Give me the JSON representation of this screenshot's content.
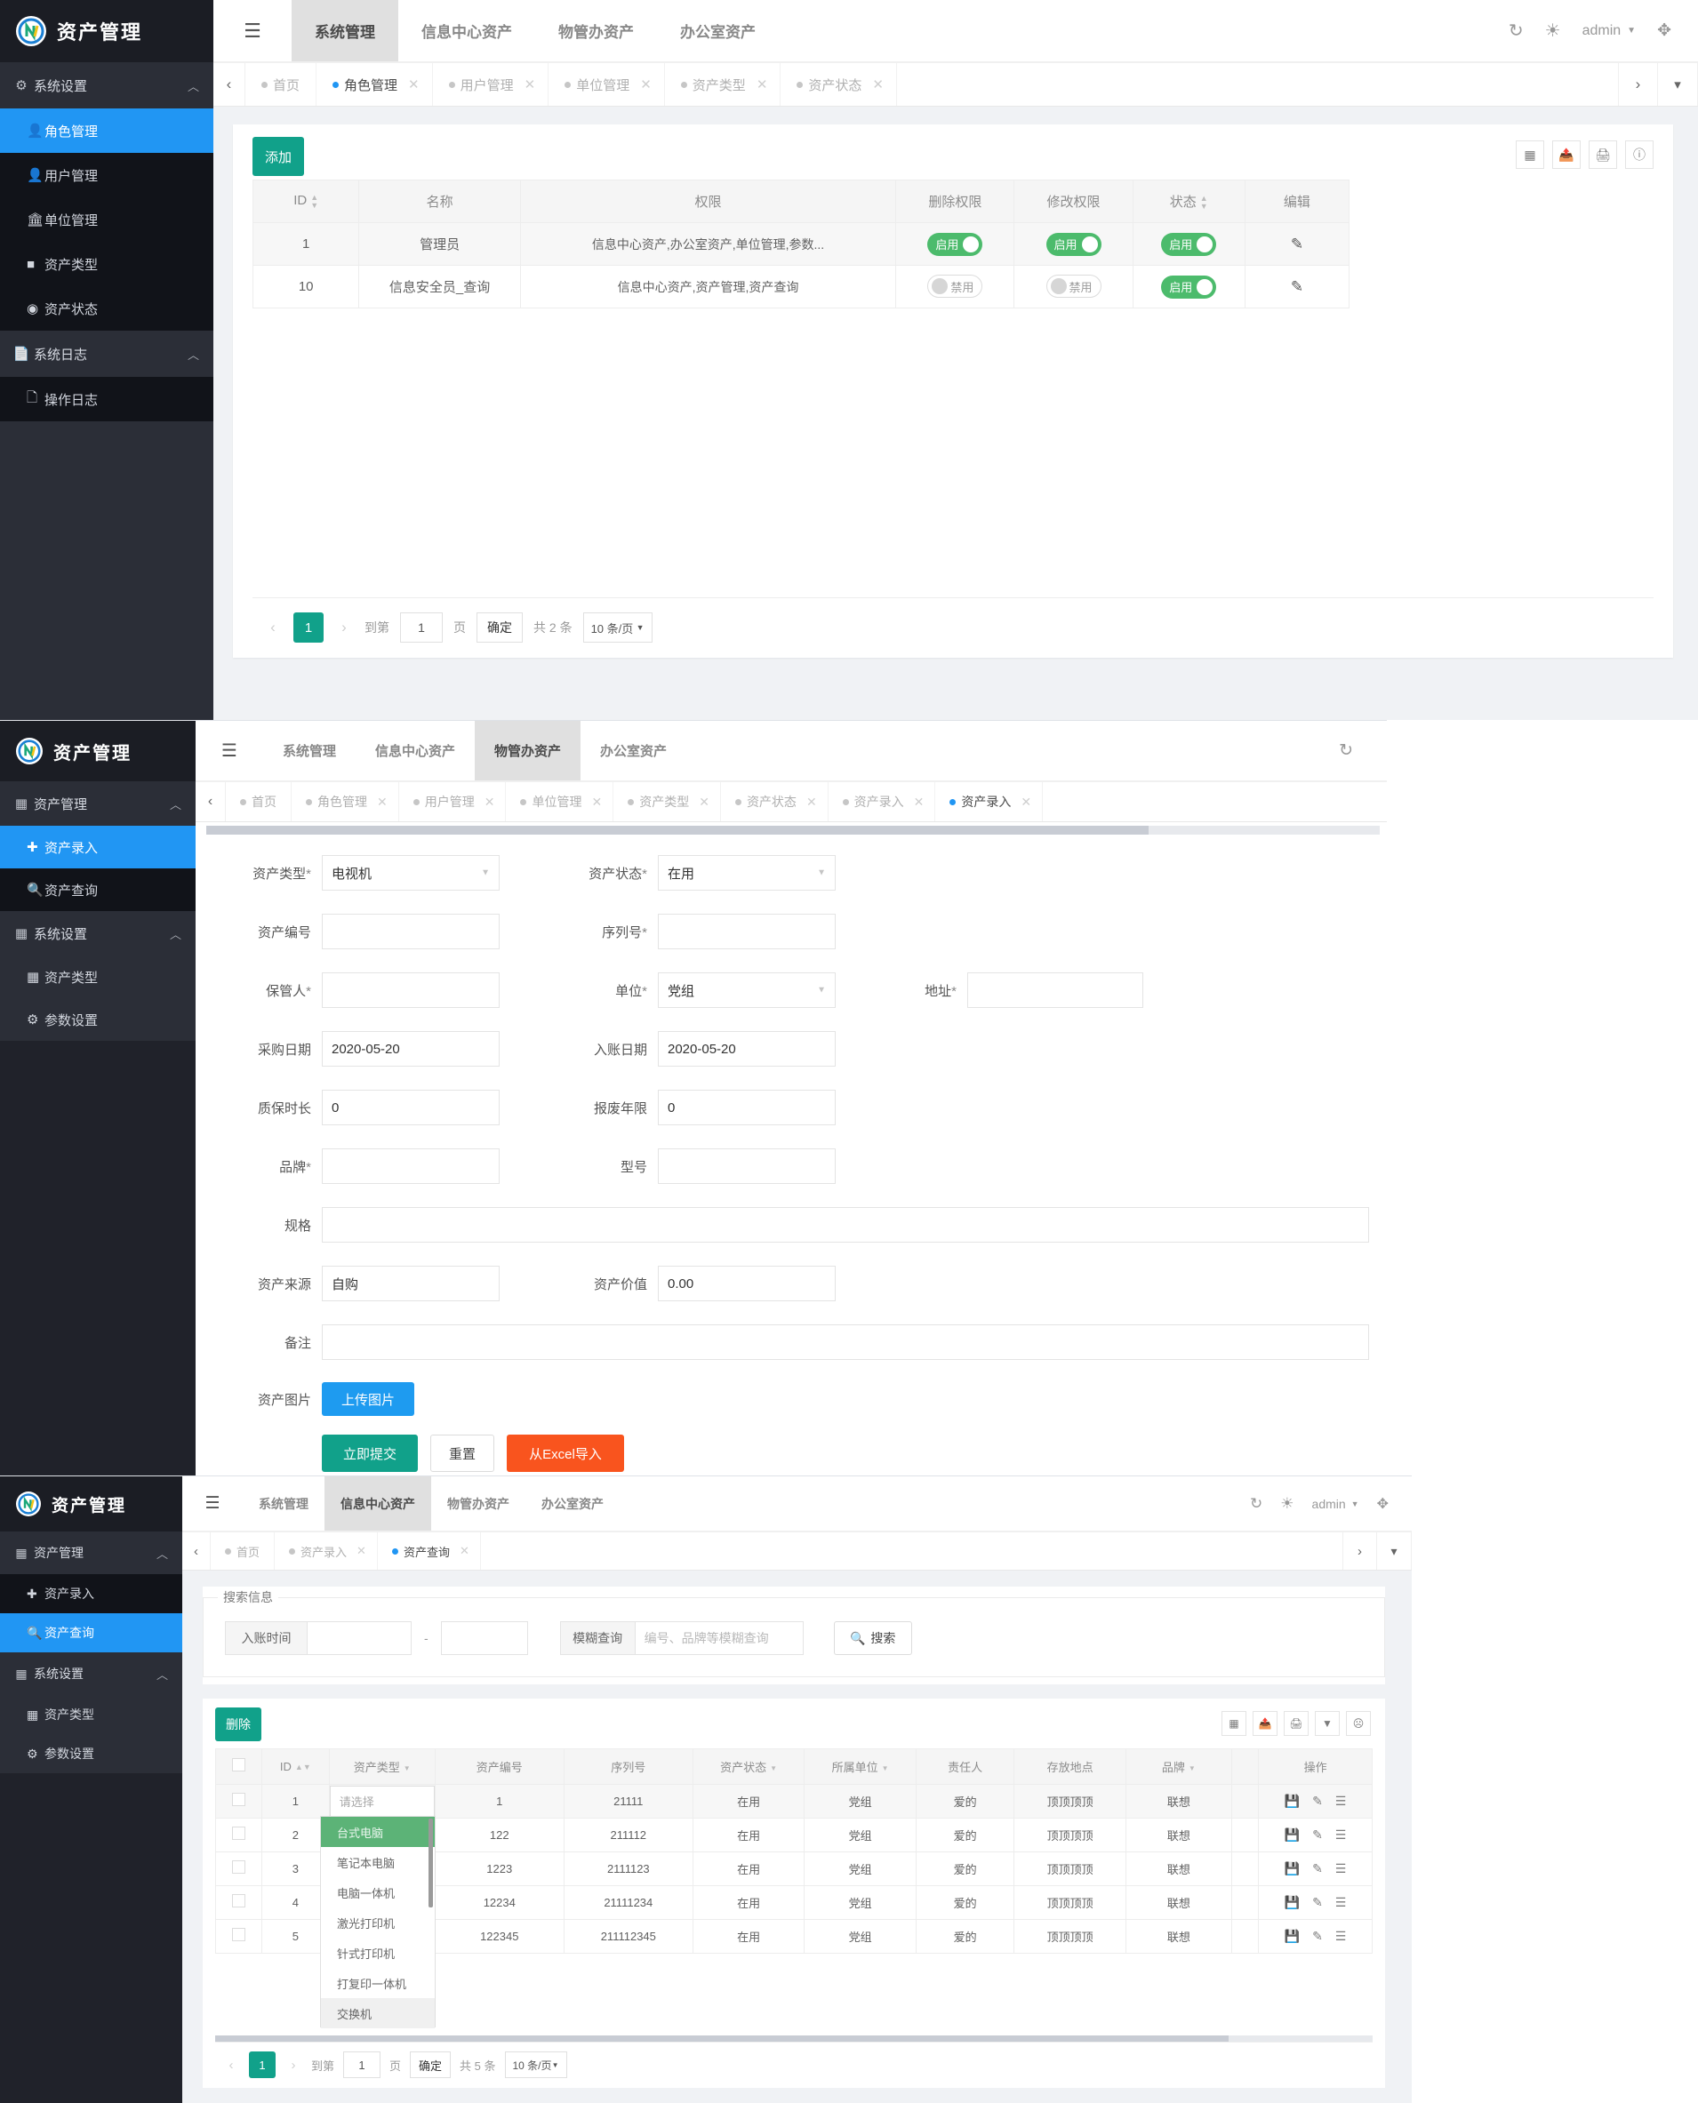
{
  "brand": {
    "title": "资产管理"
  },
  "panel1": {
    "sidebar": {
      "groups": [
        {
          "label": "系统设置",
          "icon": "gear-icon",
          "caret": "︿",
          "items": [
            {
              "label": "角色管理",
              "icon": "role-icon",
              "active": true
            },
            {
              "label": "用户管理",
              "icon": "user-icon",
              "active": false
            },
            {
              "label": "单位管理",
              "icon": "bank-icon",
              "active": false
            },
            {
              "label": "资产类型",
              "icon": "type-icon",
              "active": false
            },
            {
              "label": "资产状态",
              "icon": "box-icon",
              "active": false
            }
          ]
        },
        {
          "label": "系统日志",
          "icon": "log-icon",
          "caret": "︿",
          "items": [
            {
              "label": "操作日志",
              "icon": "doc-icon",
              "active": false
            }
          ]
        }
      ]
    },
    "topnav": {
      "tabs": [
        "系统管理",
        "信息中心资产",
        "物管办资产",
        "办公室资产"
      ],
      "active": "系统管理",
      "right": {
        "user": "admin"
      }
    },
    "tabstrip": [
      {
        "label": "首页",
        "active": false,
        "closable": false
      },
      {
        "label": "角色管理",
        "active": true,
        "closable": true
      },
      {
        "label": "用户管理",
        "active": false,
        "closable": true
      },
      {
        "label": "单位管理",
        "active": false,
        "closable": true
      },
      {
        "label": "资产类型",
        "active": false,
        "closable": true
      },
      {
        "label": "资产状态",
        "active": false,
        "closable": true
      }
    ],
    "toolbar": {
      "add_label": "添加"
    },
    "table": {
      "columns": [
        "ID",
        "名称",
        "权限",
        "删除权限",
        "修改权限",
        "状态",
        "编辑"
      ],
      "rows": [
        {
          "id": "1",
          "name": "管理员",
          "perm": "信息中心资产,办公室资产,单位管理,参数...",
          "del": "启用",
          "del_on": true,
          "mod": "启用",
          "mod_on": true,
          "state": "启用",
          "state_on": true
        },
        {
          "id": "10",
          "name": "信息安全员_查询",
          "perm": "信息中心资产,资产管理,资产查询",
          "del": "禁用",
          "del_on": false,
          "mod": "禁用",
          "mod_on": false,
          "state": "启用",
          "state_on": true
        }
      ]
    },
    "pager": {
      "page": "1",
      "goto_label": "到第",
      "goto_value": "1",
      "page_unit": "页",
      "confirm": "确定",
      "total": "共 2 条",
      "size": "10 条/页"
    }
  },
  "panel2": {
    "sidebar": {
      "groups": [
        {
          "label": "资产管理",
          "icon": "asset-icon",
          "caret": "︿",
          "items": [
            {
              "label": "资产录入",
              "icon": "plus-icon",
              "active": true
            },
            {
              "label": "资产查询",
              "icon": "search-icon",
              "active": false
            }
          ]
        },
        {
          "label": "系统设置",
          "icon": "gear-icon",
          "caret": "︿",
          "items": [
            {
              "label": "资产类型",
              "icon": "type-icon",
              "active": false
            },
            {
              "label": "参数设置",
              "icon": "cog-icon",
              "active": false
            }
          ]
        }
      ]
    },
    "topnav": {
      "tabs": [
        "系统管理",
        "信息中心资产",
        "物管办资产",
        "办公室资产"
      ],
      "active": "物管办资产"
    },
    "tabstrip": [
      {
        "label": "首页",
        "active": false,
        "closable": false
      },
      {
        "label": "角色管理",
        "active": false,
        "closable": true
      },
      {
        "label": "用户管理",
        "active": false,
        "closable": true
      },
      {
        "label": "单位管理",
        "active": false,
        "closable": true
      },
      {
        "label": "资产类型",
        "active": false,
        "closable": true
      },
      {
        "label": "资产状态",
        "active": false,
        "closable": true
      },
      {
        "label": "资产录入",
        "active": false,
        "closable": true
      },
      {
        "label": "资产录入",
        "active": true,
        "closable": true
      }
    ],
    "form": {
      "fields": {
        "asset_type": {
          "label": "资产类型",
          "required": true,
          "value": "电视机",
          "select": true
        },
        "asset_state": {
          "label": "资产状态",
          "required": true,
          "value": "在用",
          "select": true
        },
        "asset_no": {
          "label": "资产编号",
          "required": false,
          "value": ""
        },
        "serial_no": {
          "label": "序列号",
          "required": true,
          "value": ""
        },
        "keeper": {
          "label": "保管人",
          "required": true,
          "value": ""
        },
        "unit": {
          "label": "单位",
          "required": true,
          "value": "党组",
          "select": true
        },
        "address": {
          "label": "地址",
          "required": true,
          "value": ""
        },
        "buy_date": {
          "label": "采购日期",
          "required": false,
          "value": "2020-05-20"
        },
        "entry_date": {
          "label": "入账日期",
          "required": false,
          "value": "2020-05-20"
        },
        "warranty": {
          "label": "质保时长",
          "required": false,
          "value": "0"
        },
        "scrap_years": {
          "label": "报废年限",
          "required": false,
          "value": "0"
        },
        "brand": {
          "label": "品牌",
          "required": true,
          "value": ""
        },
        "model": {
          "label": "型号",
          "required": false,
          "value": ""
        },
        "spec": {
          "label": "规格",
          "required": false,
          "value": ""
        },
        "source": {
          "label": "资产来源",
          "required": false,
          "value": "自购"
        },
        "value": {
          "label": "资产价值",
          "required": false,
          "value": "0.00"
        },
        "remark": {
          "label": "备注",
          "required": false,
          "value": ""
        },
        "photo": {
          "label": "资产图片",
          "required": false,
          "upload_label": "上传图片"
        }
      },
      "buttons": {
        "submit": "立即提交",
        "reset": "重置",
        "import": "从Excel导入"
      }
    }
  },
  "panel3": {
    "sidebar": {
      "groups": [
        {
          "label": "资产管理",
          "icon": "asset-icon",
          "caret": "︿",
          "items": [
            {
              "label": "资产录入",
              "icon": "plus-icon",
              "active": false
            },
            {
              "label": "资产查询",
              "icon": "search-icon",
              "active": true
            }
          ]
        },
        {
          "label": "系统设置",
          "icon": "gear-icon",
          "caret": "︿",
          "items": [
            {
              "label": "资产类型",
              "icon": "type-icon",
              "active": false
            },
            {
              "label": "参数设置",
              "icon": "cog-icon",
              "active": false
            }
          ]
        }
      ]
    },
    "topnav": {
      "tabs": [
        "系统管理",
        "信息中心资产",
        "物管办资产",
        "办公室资产"
      ],
      "active": "信息中心资产",
      "right": {
        "user": "admin"
      }
    },
    "tabstrip": [
      {
        "label": "首页",
        "active": false,
        "closable": false
      },
      {
        "label": "资产录入",
        "active": false,
        "closable": true
      },
      {
        "label": "资产查询",
        "active": true,
        "closable": true
      }
    ],
    "search": {
      "legend": "搜索信息",
      "date_label": "入账时间",
      "date_from": "",
      "date_to": "",
      "separator": "-",
      "fuzzy_label": "模糊查询",
      "fuzzy_placeholder": "编号、品牌等模糊查询",
      "search_button": "搜索"
    },
    "toolbar": {
      "delete_label": "删除"
    },
    "table": {
      "columns": [
        "ID",
        "资产类型",
        "资产编号",
        "序列号",
        "资产状态",
        "所属单位",
        "责任人",
        "存放地点",
        "品牌",
        "操作"
      ],
      "rows": [
        {
          "id": "1",
          "type": "请选择",
          "no": "1",
          "serial": "21111",
          "state": "在用",
          "unit": "党组",
          "owner": "爱的",
          "place": "顶顶顶顶",
          "brand": "联想"
        },
        {
          "id": "2",
          "type": "",
          "no": "122",
          "serial": "211112",
          "state": "在用",
          "unit": "党组",
          "owner": "爱的",
          "place": "顶顶顶顶",
          "brand": "联想"
        },
        {
          "id": "3",
          "type": "",
          "no": "1223",
          "serial": "2111123",
          "state": "在用",
          "unit": "党组",
          "owner": "爱的",
          "place": "顶顶顶顶",
          "brand": "联想"
        },
        {
          "id": "4",
          "type": "",
          "no": "12234",
          "serial": "21111234",
          "state": "在用",
          "unit": "党组",
          "owner": "爱的",
          "place": "顶顶顶顶",
          "brand": "联想"
        },
        {
          "id": "5",
          "type": "",
          "no": "122345",
          "serial": "211112345",
          "state": "在用",
          "unit": "党组",
          "owner": "爱的",
          "place": "顶顶顶顶",
          "brand": "联想"
        }
      ]
    },
    "dropdown": {
      "options": [
        "台式电脑",
        "笔记本电脑",
        "电脑一体机",
        "激光打印机",
        "针式打印机",
        "打复印一体机",
        "交换机"
      ],
      "selected": "台式电脑",
      "hovered": "交换机"
    },
    "pager": {
      "page": "1",
      "goto_label": "到第",
      "goto_value": "1",
      "page_unit": "页",
      "confirm": "确定",
      "total": "共 5 条",
      "size": "10 条/页"
    }
  },
  "colors": {
    "sidebar_bg": "#20222a",
    "sidebar_group_bg": "#2b2e37",
    "sidebar_item_bg": "#111319",
    "active_blue": "#2196f3",
    "teal": "#11a18a",
    "green": "#4cbb6c",
    "orange": "#f9541e",
    "content_bg": "#f0f2f5"
  }
}
